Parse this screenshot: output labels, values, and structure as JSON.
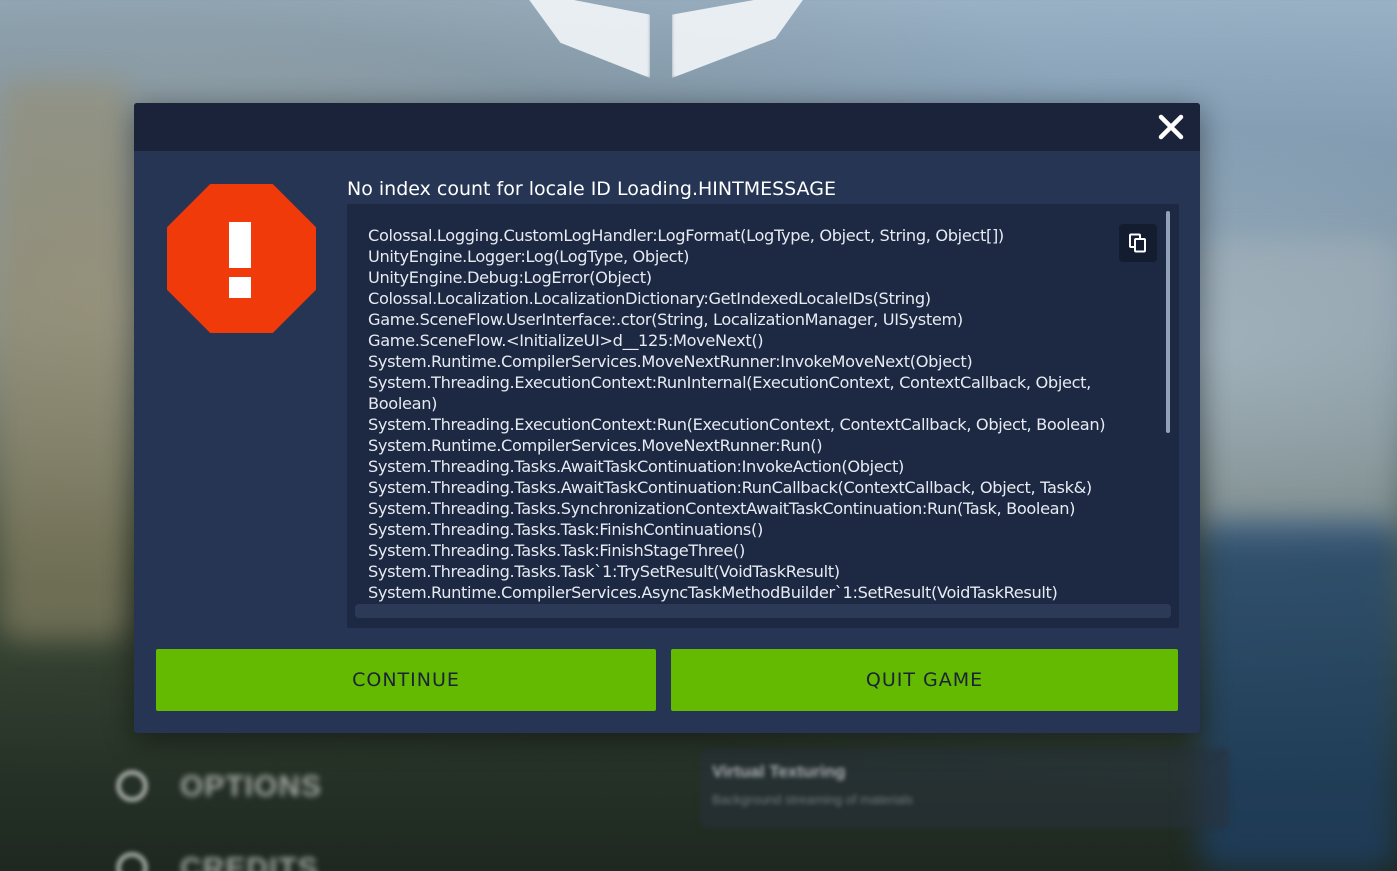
{
  "background": {
    "menu_options_label": "OPTIONS",
    "menu_credits_label": "CREDITS",
    "panel_title": "Virtual Texturing",
    "panel_subtitle": "Background streaming of materials"
  },
  "dialog": {
    "message": "No index count for locale ID Loading.HINTMESSAGE",
    "log_lines": [
      "Colossal.Logging.CustomLogHandler:LogFormat(LogType, Object, String, Object[])",
      "UnityEngine.Logger:Log(LogType, Object)",
      "UnityEngine.Debug:LogError(Object)",
      "Colossal.Localization.LocalizationDictionary:GetIndexedLocaleIDs(String)",
      "Game.SceneFlow.UserInterface:.ctor(String, LocalizationManager, UISystem)",
      "Game.SceneFlow.<InitializeUI>d__125:MoveNext()",
      "System.Runtime.CompilerServices.MoveNextRunner:InvokeMoveNext(Object)",
      "System.Threading.ExecutionContext:RunInternal(ExecutionContext, ContextCallback, Object, Boolean)",
      "System.Threading.ExecutionContext:Run(ExecutionContext, ContextCallback, Object, Boolean)",
      "System.Runtime.CompilerServices.MoveNextRunner:Run()",
      "System.Threading.Tasks.AwaitTaskContinuation:InvokeAction(Object)",
      "System.Threading.Tasks.AwaitTaskContinuation:RunCallback(ContextCallback, Object, Task&)",
      "System.Threading.Tasks.SynchronizationContextAwaitTaskContinuation:Run(Task, Boolean)",
      "System.Threading.Tasks.Task:FinishContinuations()",
      "System.Threading.Tasks.Task:FinishStageThree()",
      "System.Threading.Tasks.Task`1:TrySetResult(VoidTaskResult)",
      "System.Runtime.CompilerServices.AsyncTaskMethodBuilder`1:SetResult(VoidTaskResult)"
    ],
    "continue_label": "CONTINUE",
    "quit_label": "QUIT GAME",
    "icons": {
      "close": "close-icon",
      "error": "error-stop-icon",
      "copy": "copy-icon"
    }
  },
  "colors": {
    "dialog_bg": "#263553",
    "header_bg": "#1a2339",
    "log_bg": "#1d2842",
    "button_green": "#63ba00",
    "error_red": "#f03a0a"
  }
}
